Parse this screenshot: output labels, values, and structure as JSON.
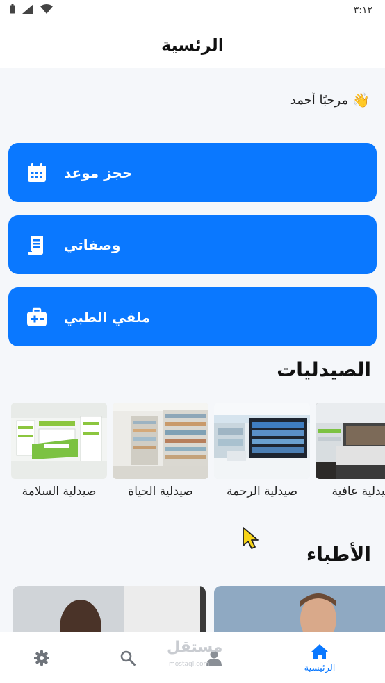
{
  "status_bar": {
    "time": "٣:١٢"
  },
  "app_bar": {
    "title": "الرئسية"
  },
  "greeting": {
    "text": "مرحبًا أحمد"
  },
  "actions": [
    {
      "label": "حجز موعد",
      "icon": "calendar-icon"
    },
    {
      "label": "وصفاتي",
      "icon": "receipt-icon"
    },
    {
      "label": "ملفي الطبي",
      "icon": "medical-kit-icon"
    }
  ],
  "pharmacies_section": {
    "title": "الصيدليات",
    "items": [
      {
        "name": "صيدلية عافية"
      },
      {
        "name": "صيدلية الرحمة"
      },
      {
        "name": "صيدلية الحياة"
      },
      {
        "name": "صيدلية السلامة"
      }
    ]
  },
  "doctors_section": {
    "title": "الأطباء"
  },
  "bottom_nav": {
    "home_label": "الرئيسية",
    "items": [
      "home-icon",
      "profile-icon",
      "search-icon",
      "settings-icon"
    ]
  },
  "watermark": {
    "main": "مستقل",
    "sub": "mostaql.com"
  },
  "colors": {
    "primary": "#0a78ff",
    "background": "#f5f7fa"
  }
}
